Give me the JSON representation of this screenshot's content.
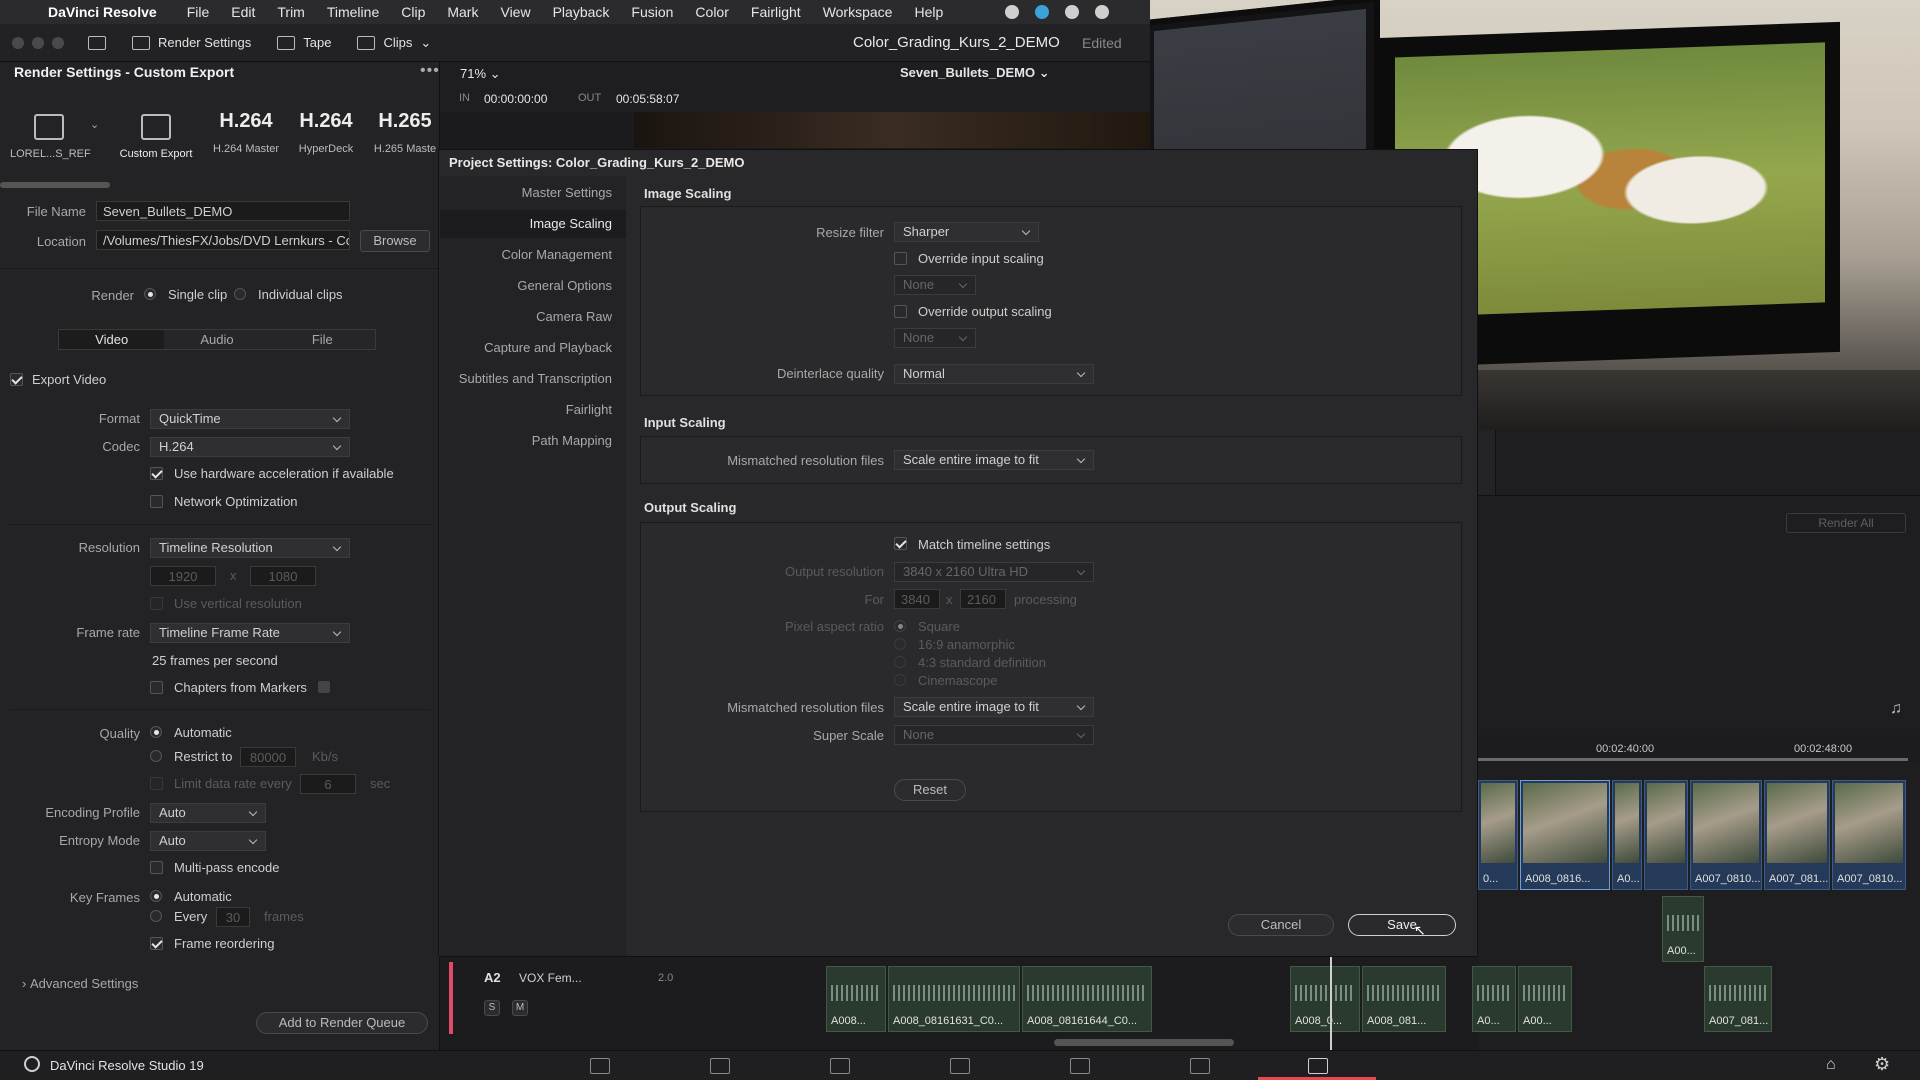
{
  "menubar": {
    "app_name": "DaVinci Resolve",
    "items": [
      "File",
      "Edit",
      "Trim",
      "Timeline",
      "Clip",
      "Mark",
      "View",
      "Playback",
      "Fusion",
      "Color",
      "Fairlight",
      "Workspace",
      "Help"
    ]
  },
  "toolbar": {
    "render_settings": "Render Settings",
    "tape": "Tape",
    "clips": "Clips",
    "project_title": "Color_Grading_Kurs_2_DEMO",
    "edited": "Edited"
  },
  "render_panel": {
    "title": "Render Settings - Custom Export",
    "presets": [
      {
        "big": "",
        "label": "LOREL...S_REF"
      },
      {
        "big": "",
        "label": "Custom Export"
      },
      {
        "big": "H.264",
        "label": "H.264 Master"
      },
      {
        "big": "H.264",
        "label": "HyperDeck"
      },
      {
        "big": "H.265",
        "label": "H.265 Maste"
      }
    ],
    "file_name_label": "File Name",
    "file_name": "Seven_Bullets_DEMO",
    "location_label": "Location",
    "location": "/Volumes/ThiesFX/Jobs/DVD Lernkurs - Color",
    "browse": "Browse",
    "render_label": "Render",
    "single_clip": "Single clip",
    "individual_clips": "Individual clips",
    "tabs": [
      "Video",
      "Audio",
      "File"
    ],
    "export_video": "Export Video",
    "format_label": "Format",
    "format": "QuickTime",
    "codec_label": "Codec",
    "codec": "H.264",
    "hw_accel": "Use hardware acceleration if available",
    "network_opt": "Network Optimization",
    "resolution_label": "Resolution",
    "resolution": "Timeline Resolution",
    "res_w": "1920",
    "res_x": "x",
    "res_h": "1080",
    "vertical_res": "Use vertical resolution",
    "frame_rate_label": "Frame rate",
    "frame_rate": "Timeline Frame Rate",
    "fps_text": "25 frames per second",
    "chapters": "Chapters from Markers",
    "quality_label": "Quality",
    "quality_auto": "Automatic",
    "restrict_to": "Restrict to",
    "restrict_value": "80000",
    "restrict_unit": "Kb/s",
    "limit_rate": "Limit data rate every",
    "limit_value": "6",
    "limit_unit": "sec",
    "encoding_profile_label": "Encoding Profile",
    "encoding_profile": "Auto",
    "entropy_label": "Entropy Mode",
    "entropy": "Auto",
    "multipass": "Multi-pass encode",
    "keyframes_label": "Key Frames",
    "kf_auto": "Automatic",
    "kf_every": "Every",
    "kf_value": "30",
    "kf_unit": "frames",
    "frame_reorder": "Frame reordering",
    "advanced": "Advanced Settings",
    "add_queue": "Add to Render Queue"
  },
  "viewer": {
    "zoom": "71%",
    "timeline_name": "Seven_Bullets_DEMO",
    "in_label": "IN",
    "in_tc": "00:00:00:00",
    "out_label": "OUT",
    "out_tc": "00:05:58:07"
  },
  "dialog": {
    "title": "Project Settings:  Color_Grading_Kurs_2_DEMO",
    "nav": [
      "Master Settings",
      "Image Scaling",
      "Color Management",
      "General Options",
      "Camera Raw",
      "Capture and Playback",
      "Subtitles and Transcription",
      "Fairlight",
      "Path Mapping"
    ],
    "image_scaling": {
      "header": "Image Scaling",
      "resize_filter_label": "Resize filter",
      "resize_filter": "Sharper",
      "override_input": "Override input scaling",
      "none1": "None",
      "override_output": "Override output scaling",
      "none2": "None",
      "deinterlace_label": "Deinterlace quality",
      "deinterlace": "Normal"
    },
    "input_scaling": {
      "header": "Input Scaling",
      "mismatched_label": "Mismatched resolution files",
      "mismatched": "Scale entire image to fit"
    },
    "output_scaling": {
      "header": "Output Scaling",
      "match_timeline": "Match timeline settings",
      "output_res_label": "Output resolution",
      "output_res": "3840 x 2160 Ultra HD",
      "for_label": "For",
      "for_w": "3840",
      "for_x": "x",
      "for_h": "2160",
      "processing": "processing",
      "par_label": "Pixel aspect ratio",
      "par_options": [
        "Square",
        "16:9 anamorphic",
        "4:3 standard definition",
        "Cinemascope"
      ],
      "mismatched_label": "Mismatched resolution files",
      "mismatched": "Scale entire image to fit",
      "super_scale_label": "Super Scale",
      "super_scale": "None",
      "reset": "Reset"
    },
    "cancel": "Cancel",
    "save": "Save"
  },
  "render_queue": {
    "render_all": "Render All"
  },
  "timeline": {
    "tc1": "00:02:40:00",
    "tc2": "00:02:48:00",
    "video_clips": [
      "0...",
      "A008_0816...",
      "A0...",
      "A007_0810...",
      "A007_081...",
      "A007_0810..."
    ],
    "audio_clip_top": "A00...",
    "track_name": "A2",
    "track_title": "VOX Fem...",
    "track_ch": "2.0",
    "solo": "S",
    "mute": "M",
    "audio_clips": [
      "A008...",
      "A008_08161631_C0...",
      "A008_08161644_C0...",
      "A008_0...",
      "A008_081...",
      "A0...",
      "A00...",
      "A007_081..."
    ]
  },
  "footer": {
    "app": "DaVinci Resolve Studio 19"
  },
  "colors": {
    "accent_red": "#e64b4b",
    "clip_blue": "#243a58"
  }
}
